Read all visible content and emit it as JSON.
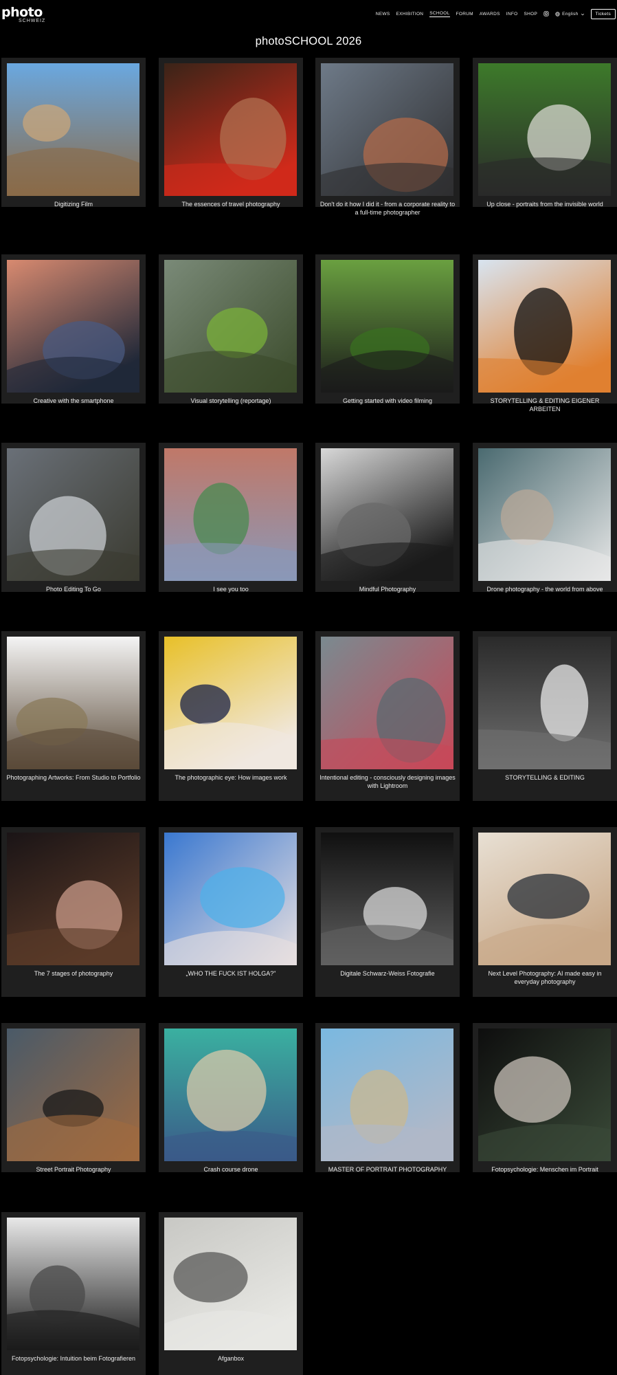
{
  "logo": {
    "main": "photo",
    "sub": "SCHWEIZ"
  },
  "nav": {
    "items": [
      {
        "label": "NEWS",
        "active": false
      },
      {
        "label": "EXHIBITION",
        "active": false
      },
      {
        "label": "SCHOOL",
        "active": true
      },
      {
        "label": "FORUM",
        "active": false
      },
      {
        "label": "AWARDS",
        "active": false
      },
      {
        "label": "INFO",
        "active": false
      },
      {
        "label": "SHOP",
        "active": false
      }
    ],
    "language": "English",
    "tickets": "Tickets"
  },
  "page_title": "photoSCHOOL 2026",
  "courses": [
    {
      "title": "Digitizing Film",
      "palette": [
        "#6aa8e0",
        "#c9a57a",
        "#8a6a48"
      ]
    },
    {
      "title": "The essences of travel photography",
      "palette": [
        "#3a2418",
        "#b07050",
        "#d02a1a"
      ]
    },
    {
      "title": "Don't do it how I did it - from a corporate reality to a full-time photographer",
      "palette": [
        "#6e7a88",
        "#b06a4a",
        "#2e2e30"
      ]
    },
    {
      "title": "Up close - portraits from the invisible world",
      "palette": [
        "#3d7a2a",
        "#d8d8d0",
        "#2a2a2a"
      ]
    },
    {
      "title": "Creative with the smartphone",
      "palette": [
        "#d88a70",
        "#4a5a80",
        "#202838"
      ]
    },
    {
      "title": "Visual storytelling (reportage)",
      "palette": [
        "#7a8a78",
        "#7ab03a",
        "#3a4a2a"
      ]
    },
    {
      "title": "Getting started with video filming",
      "palette": [
        "#6aa040",
        "#3a7020",
        "#1a1a1a"
      ]
    },
    {
      "title": "STORYTELLING & EDITING EIGENER ARBEITEN",
      "palette": [
        "#d8e4f0",
        "#101010",
        "#e08030"
      ]
    },
    {
      "title": "Photo Editing To Go",
      "palette": [
        "#6a7078",
        "#c8ccd0",
        "#3a3a30"
      ]
    },
    {
      "title": "I see you too",
      "palette": [
        "#c07868",
        "#4a8a50",
        "#8a98b8"
      ]
    },
    {
      "title": "Mindful Photography",
      "palette": [
        "#d8d8d8",
        "#6a6a6a",
        "#1a1a1a"
      ]
    },
    {
      "title": "Drone photography - the world from above",
      "palette": [
        "#4a6a70",
        "#b8a898",
        "#e8e8e8"
      ]
    },
    {
      "title": "Photographing Artworks: From Studio to Portfolio",
      "palette": [
        "#f4f4f4",
        "#8a7a5a",
        "#5a4a38"
      ]
    },
    {
      "title": "The photographic eye: How images work",
      "palette": [
        "#e8c028",
        "#182048",
        "#f0e8e0"
      ]
    },
    {
      "title": "Intentional editing - consciously designing images with Lightroom",
      "palette": [
        "#7a8a90",
        "#5a6a70",
        "#c84858"
      ]
    },
    {
      "title": "STORYTELLING & EDITING",
      "palette": [
        "#2a2a2a",
        "#e8e8e8",
        "#707070"
      ]
    },
    {
      "title": "The 7 stages of photography",
      "palette": [
        "#1a1416",
        "#c89a88",
        "#5a3a28"
      ]
    },
    {
      "title": "„WHO THE FUCK IST HOLGA?\"",
      "palette": [
        "#3a78d0",
        "#50b0e8",
        "#e8e0e0"
      ]
    },
    {
      "title": "Digitale Schwarz-Weiss Fotografie",
      "palette": [
        "#101010",
        "#d8d8d8",
        "#606060"
      ]
    },
    {
      "title": "Next Level Photography: AI made easy in everyday photography",
      "palette": [
        "#e8e0d4",
        "#2a3038",
        "#c8a888"
      ]
    },
    {
      "title": "Street Portrait Photography",
      "palette": [
        "#4a5a68",
        "#1a1a1a",
        "#a06a40"
      ]
    },
    {
      "title": "Crash course drone",
      "palette": [
        "#3ab0a0",
        "#d8c8a8",
        "#3a5a88"
      ]
    },
    {
      "title": "MASTER OF PORTRAIT PHOTOGRAPHY",
      "palette": [
        "#7ab8e0",
        "#c8b890",
        "#b0b8c8"
      ]
    },
    {
      "title": "Fotopsychologie: Menschen im Portrait",
      "palette": [
        "#0e0e0e",
        "#c8c0b8",
        "#3a4a38"
      ]
    },
    {
      "title": "Fotopsychologie: Intuition beim Fotografieren",
      "palette": [
        "#e8e8e8",
        "#4a4a4a",
        "#1a1a1a"
      ]
    },
    {
      "title": "Afganbox",
      "palette": [
        "#c8c8c4",
        "#5a5a58",
        "#e8e8e4"
      ]
    }
  ]
}
